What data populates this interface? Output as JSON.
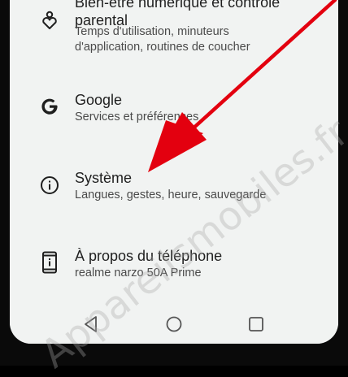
{
  "settings_items": [
    {
      "title_lines": [
        "Bien-être numérique et contrôle",
        "parental"
      ],
      "subtitle_lines": [
        "Temps d'utilisation, minuteurs",
        "d'application, routines de coucher"
      ],
      "icon": "heart-person-icon"
    },
    {
      "title": "Google",
      "subtitle": "Services et préférences",
      "icon": "google-g-icon"
    },
    {
      "title": "Système",
      "subtitle": "Langues, gestes, heure, sauvegarde",
      "icon": "info-icon"
    },
    {
      "title": "À propos du téléphone",
      "subtitle": "realme narzo 50A Prime",
      "icon": "phone-info-icon"
    }
  ],
  "navbar": {
    "buttons": [
      "back-icon",
      "home-icon",
      "recents-icon"
    ]
  },
  "watermark": "Appareilsmobiles.fr",
  "colors": {
    "arrow": "#e3000f",
    "screen_bg": "#f1f3f2",
    "bezel": "#0a0a0a"
  }
}
